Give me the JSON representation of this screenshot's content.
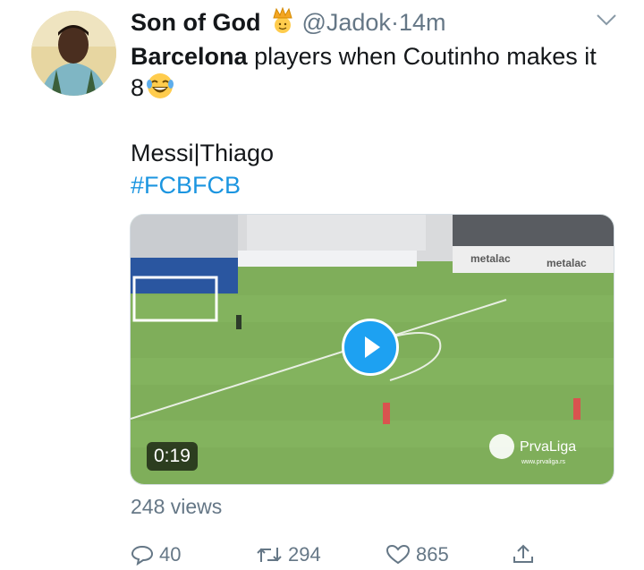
{
  "user": {
    "display_name": "Son of God",
    "handle": "@Jadok",
    "separator": "·",
    "time": "14m"
  },
  "tweet": {
    "bold_word": "Barcelona",
    "text_rest": " players when Coutinho makes it",
    "line2": "8",
    "line3": "Messi|Thiago",
    "hashtag": "#FCBFCB"
  },
  "video": {
    "duration": "0:19",
    "sponsor_label": "metalac",
    "league_label": "PrvaLiga",
    "league_url": "www.prvaliga.rs"
  },
  "views": "248 views",
  "actions": {
    "reply_count": "40",
    "retweet_count": "294",
    "like_count": "865"
  },
  "icons": [
    "crown-emoji-icon",
    "chevron-down-icon",
    "laughing-emoji-icon",
    "play-icon",
    "reply-icon",
    "retweet-icon",
    "like-icon",
    "share-icon"
  ],
  "colors": {
    "link": "#1b95e0",
    "muted": "#657786",
    "play_button": "#1da1f2"
  }
}
